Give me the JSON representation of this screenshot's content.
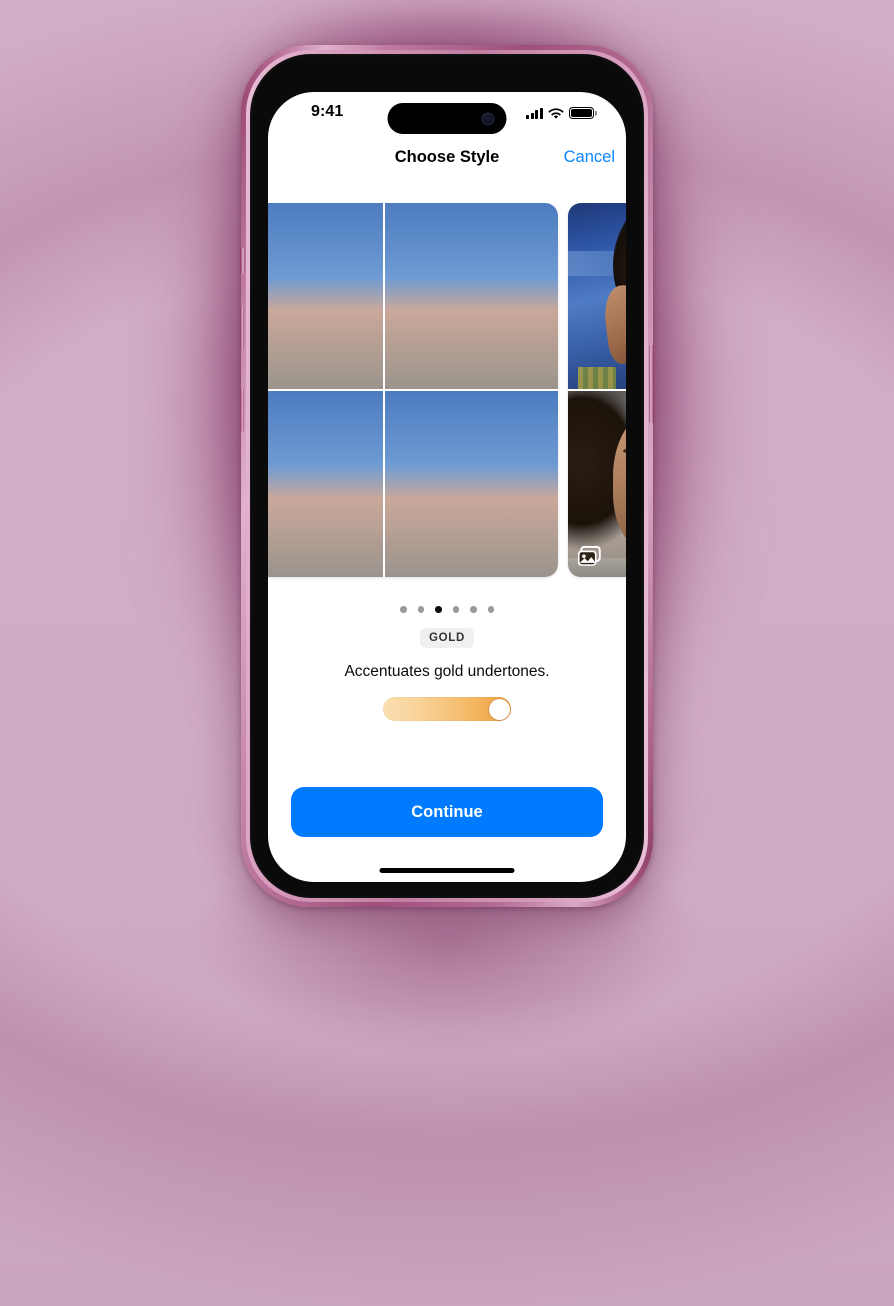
{
  "theme": {
    "page_background": "#d2aec6",
    "device_frame": "#b3699a",
    "accent_blue": "#007aff",
    "link_blue": "#0a84ff",
    "screen_background": "#ffffff",
    "slider_gradient_from": "#fbdfb2",
    "slider_gradient_to": "#ef9f3c",
    "badge_background": "#f0f0f1",
    "dot_inactive": "#9a9a9d",
    "dot_active": "#0b0b0c"
  },
  "status_bar": {
    "time": "9:41",
    "cellular_icon": "cellular-bars-icon",
    "cellular_bars": 4,
    "wifi_icon": "wifi-icon",
    "battery_icon": "battery-full-icon",
    "battery_level": 100,
    "dynamic_island": "dynamic-island"
  },
  "nav_bar": {
    "title": "Choose Style",
    "cancel_label": "Cancel"
  },
  "carousel": {
    "current_index": 2,
    "total": 6,
    "cards": [
      {
        "id": "style-prev",
        "partial": true
      },
      {
        "id": "style-gold",
        "partial": false,
        "tiles": [
          {
            "name": "photo-sunglasses-blue-wall"
          },
          {
            "name": "photo-sky-portrait"
          },
          {
            "name": "photo-closeup-portrait",
            "badge_icon": "photo-library-icon"
          },
          {
            "name": "photo-striped-dress-blue-wall"
          }
        ]
      },
      {
        "id": "style-next",
        "partial": true
      }
    ]
  },
  "style_info": {
    "badge_label": "GOLD",
    "description": "Accentuates gold undertones."
  },
  "intensity_slider": {
    "name": "intensity-slider",
    "value": 100,
    "min": 0,
    "max": 100
  },
  "footer": {
    "continue_label": "Continue",
    "home_indicator": "home-indicator"
  }
}
